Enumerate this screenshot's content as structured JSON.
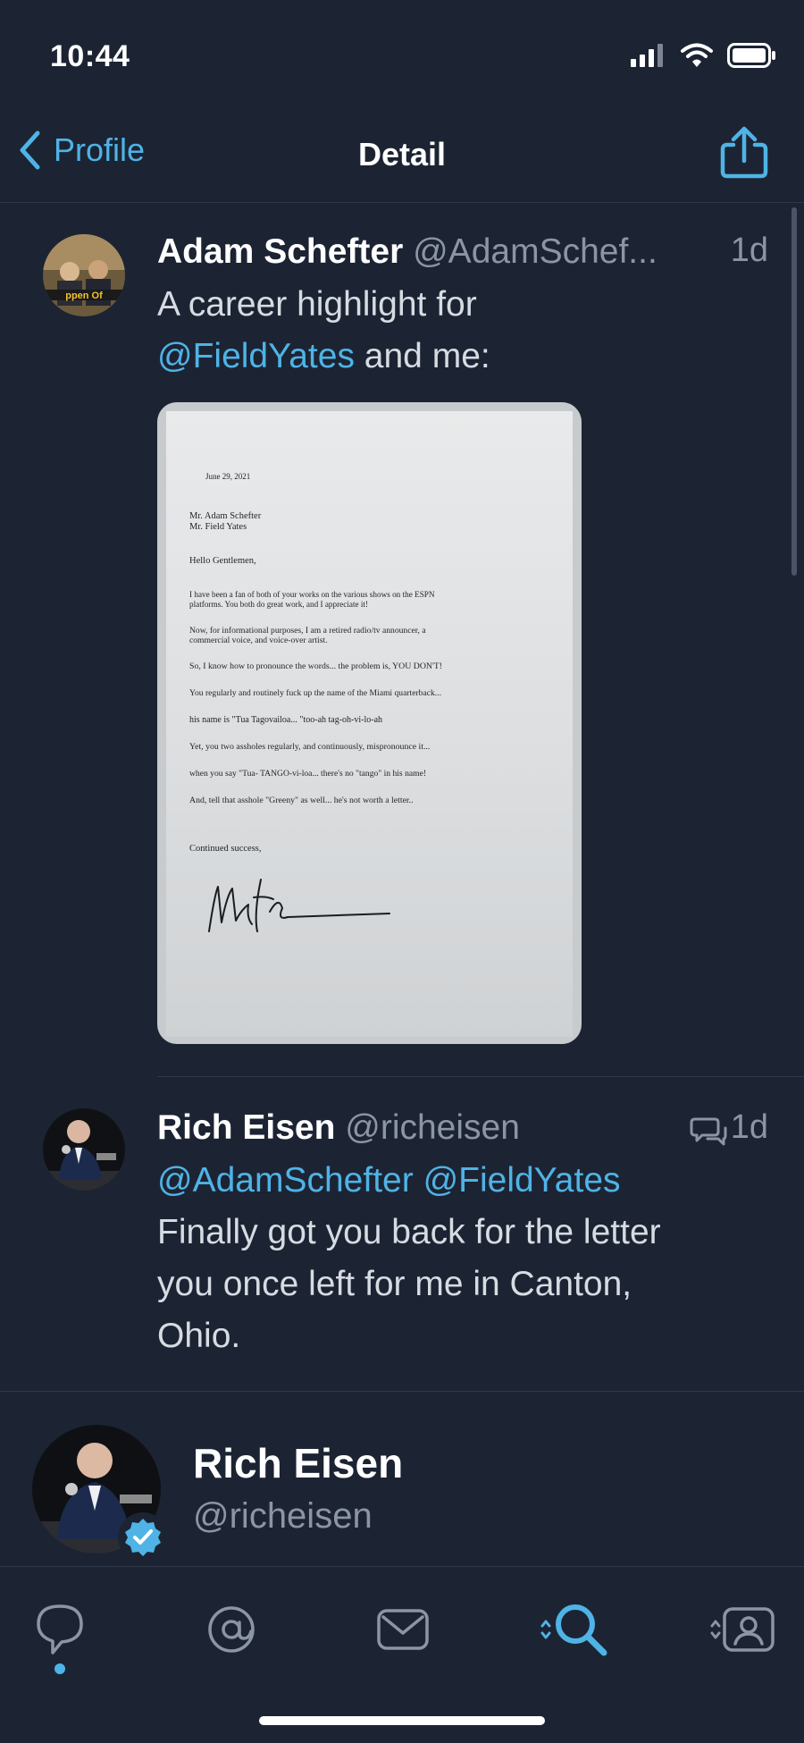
{
  "status_bar": {
    "time": "10:44"
  },
  "nav": {
    "back_label": "Profile",
    "title": "Detail"
  },
  "tweets": [
    {
      "name": "Adam Schefter",
      "handle": "@AdamSchef...",
      "time": "1d",
      "text_line1": "A career highlight for",
      "mention": "@FieldYates",
      "text_after_mention": " and me:"
    },
    {
      "name": "Rich Eisen",
      "handle": "@richeisen",
      "time": "1d",
      "mentions": [
        "@AdamSchefter",
        "@FieldYates"
      ],
      "text_lines": [
        "Finally got you back for the letter",
        "you once left for me in Canton,",
        "Ohio."
      ]
    }
  ],
  "letter": {
    "date": "June 29, 2021",
    "to1": "Mr. Adam Schefter",
    "to2": "Mr. Field Yates",
    "greeting": "Hello Gentlemen,",
    "p1a": "I have been a fan of both of your works on the various shows on the ESPN",
    "p1b": "platforms.  You both do great work, and I appreciate it!",
    "p2a": "Now, for informational purposes, I am a retired radio/tv announcer, a",
    "p2b": "commercial voice, and voice-over artist.",
    "p3": "So, I know how to pronounce the words... the problem is, YOU DON'T!",
    "p4": "You regularly and routinely fuck up the name of the Miami quarterback...",
    "p5": "his name is  \"Tua Tagovailoa...   \"too-ah   tag-oh-vi-lo-ah",
    "p6": "Yet, you two assholes regularly, and continuously, mispronounce it...",
    "p7": "when you say \"Tua- TANGO-vi-loa...   there's  no \"tango\" in his name!",
    "p8": "And, tell that asshole \"Greeny\" as well... he's not worth a letter..",
    "closing": "Continued success,"
  },
  "profile_card": {
    "name": "Rich Eisen",
    "handle": "@richeisen"
  },
  "tabs": [
    {
      "icon": "chat-bubble-icon",
      "active": true
    },
    {
      "icon": "at-mention-icon"
    },
    {
      "icon": "envelope-icon"
    },
    {
      "icon": "search-icon"
    },
    {
      "icon": "profile-card-icon"
    }
  ],
  "colors": {
    "background": "#1c2433",
    "accent": "#4fb3e6",
    "muted": "#8b95a4"
  }
}
